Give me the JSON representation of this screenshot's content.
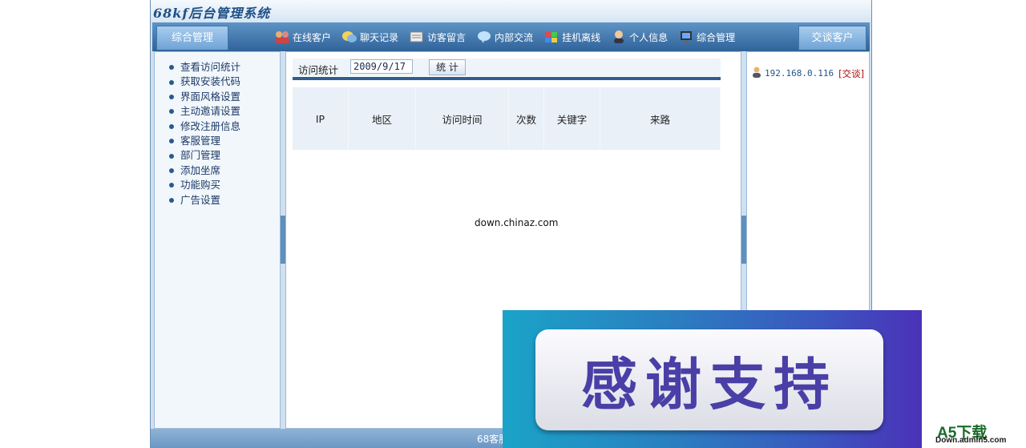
{
  "app": {
    "title": "68kf后台管理系统"
  },
  "nav": {
    "left_tab": "综合管理",
    "items": [
      {
        "label": "在线客户",
        "icon": "online-customers-icon"
      },
      {
        "label": "聊天记录",
        "icon": "chat-record-icon"
      },
      {
        "label": "访客留言",
        "icon": "visitor-message-icon"
      },
      {
        "label": "内部交流",
        "icon": "internal-chat-icon"
      },
      {
        "label": "挂机离线",
        "icon": "offline-icon"
      },
      {
        "label": "个人信息",
        "icon": "personal-info-icon"
      },
      {
        "label": "综合管理",
        "icon": "management-icon"
      }
    ],
    "right_tab": "交谈客户"
  },
  "sidebar": {
    "items": [
      {
        "label": "查看访问统计"
      },
      {
        "label": "获取安装代码"
      },
      {
        "label": "界面风格设置"
      },
      {
        "label": "主动邀请设置"
      },
      {
        "label": "修改注册信息"
      },
      {
        "label": "客服管理"
      },
      {
        "label": "部门管理"
      },
      {
        "label": "添加坐席"
      },
      {
        "label": "功能购买"
      },
      {
        "label": "广告设置"
      }
    ]
  },
  "stats": {
    "label": "访问统计",
    "date_value": "2009/9/17",
    "button_label": "统 计",
    "columns": [
      "IP",
      "地区",
      "访问时间",
      "次数",
      "关键字",
      "来路"
    ]
  },
  "center_watermark": "down.chinaz.com",
  "visitor_panel": {
    "ip": "192.168.0.116",
    "action": "[交谈]"
  },
  "statusbar": {
    "text": "68客服"
  },
  "overlay_banner": {
    "text": "感谢支持"
  },
  "site_logo": {
    "main": "A5下载",
    "sub": "Down.admin5.com"
  },
  "colors": {
    "nav_bg": "#2f6399",
    "accent": "#4a3fa6",
    "link_red": "#b01010"
  }
}
